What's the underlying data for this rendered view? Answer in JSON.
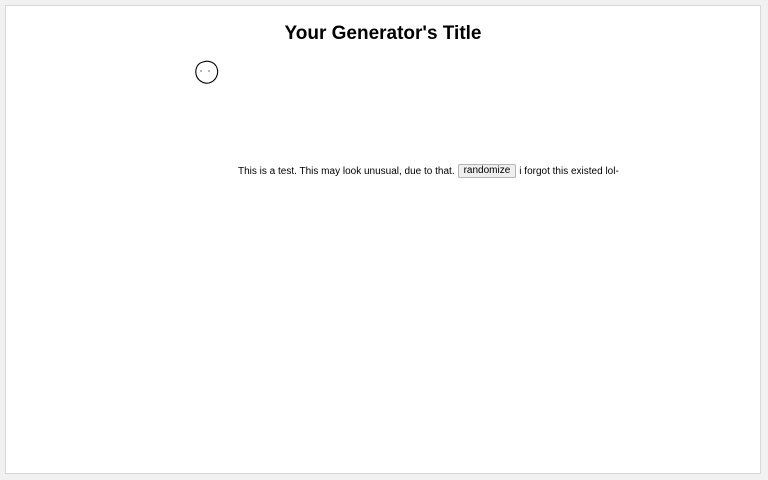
{
  "header": {
    "title": "Your Generator's Title"
  },
  "drawing": {
    "icon": "doodle-face-icon"
  },
  "content": {
    "text_before": "This is a test. This may look unusual, due to that.",
    "randomize_label": "randomize",
    "text_after": "i forgot this existed lol-"
  }
}
